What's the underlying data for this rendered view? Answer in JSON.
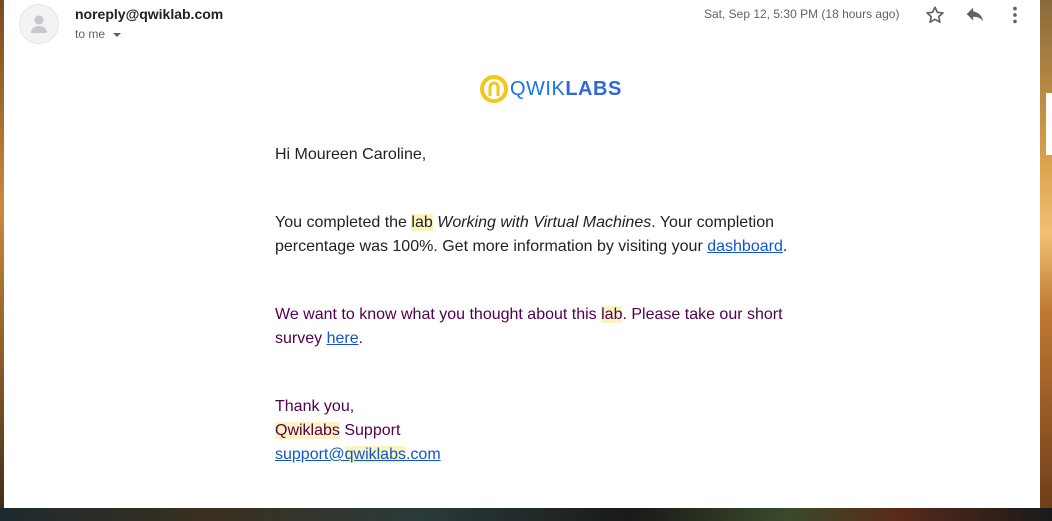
{
  "header": {
    "sender": "noreply@qwiklab.com",
    "recipient": "to me",
    "date": "Sat, Sep 12, 5:30 PM (18 hours ago)"
  },
  "icons": {
    "avatar": "person-avatar-icon",
    "star": "star-icon",
    "reply": "reply-icon",
    "more": "more-vert-icon",
    "logo": "qwiklabs-logo-icon"
  },
  "logo": {
    "part1": "QWIK",
    "part2": "LABS"
  },
  "message": {
    "greeting": "Hi Moureen Caroline,",
    "p1_a": "You completed the ",
    "p1_hl": "lab",
    "p1_b": " ",
    "p1_title": "Working with Virtual Machines",
    "p1_c": ". Your completion percentage was 100%. Get more information by visiting your ",
    "p1_link": "dashboard",
    "p1_d": ".",
    "p2_a": "We want to know what you thought about this ",
    "p2_hl": "lab",
    "p2_b": ". Please take our short survey ",
    "p2_link": "here",
    "p2_c": ".",
    "signoff": "Thank you,",
    "sig_hl": "Qwiklabs",
    "sig_rest": " Support",
    "email_a": "support@",
    "email_hl": "qwiklabs",
    "email_b": ".com"
  },
  "colors": {
    "link": "#1155cc",
    "quoted_text": "#500050",
    "highlight": "#fbf4c0",
    "logo_yellow": "#f5c518",
    "logo_blue": "#3367d6"
  }
}
